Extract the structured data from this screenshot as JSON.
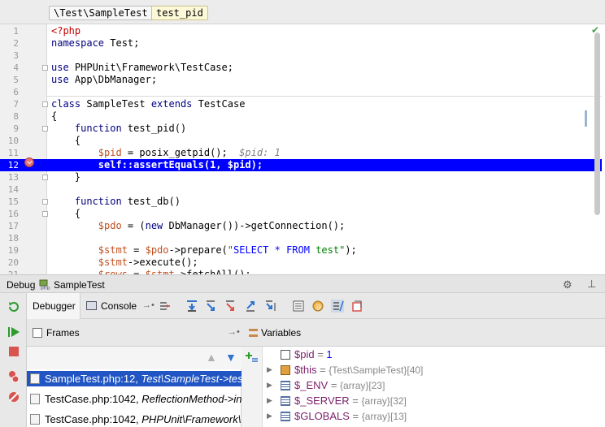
{
  "breadcrumb": {
    "namespace": "\\Test\\SampleTest",
    "method": "test_pid"
  },
  "editor": {
    "lines": [
      {
        "no": "1",
        "code": "<?php"
      },
      {
        "no": "2",
        "code": "namespace Test;"
      },
      {
        "no": "3",
        "code": ""
      },
      {
        "no": "4",
        "code": "use PHPUnit\\Framework\\TestCase;"
      },
      {
        "no": "5",
        "code": "use App\\DbManager;"
      },
      {
        "no": "6",
        "code": ""
      },
      {
        "no": "7",
        "code": "class SampleTest extends TestCase"
      },
      {
        "no": "8",
        "code": "{"
      },
      {
        "no": "9",
        "code": "    function test_pid()"
      },
      {
        "no": "10",
        "code": "    {"
      },
      {
        "no": "11",
        "code": "        $pid = posix_getpid();"
      },
      {
        "no": "12",
        "code": "        self::assertEquals(1, $pid);"
      },
      {
        "no": "13",
        "code": "    }"
      },
      {
        "no": "14",
        "code": ""
      },
      {
        "no": "15",
        "code": "    function test_db()"
      },
      {
        "no": "16",
        "code": "    {"
      },
      {
        "no": "17",
        "code": "        $pdo = (new DbManager())->getConnection();"
      },
      {
        "no": "18",
        "code": ""
      },
      {
        "no": "19",
        "code": "        $stmt = $pdo->prepare(\"SELECT * FROM test\");"
      },
      {
        "no": "20",
        "code": "        $stmt->execute();"
      },
      {
        "no": "21",
        "code": "        $rows = $stmt->fetchAll();"
      }
    ],
    "inline_hint": "$pid: 1",
    "current_line": "12"
  },
  "debug": {
    "title": "Debug",
    "session": "SampleTest",
    "tabs": {
      "debugger": "Debugger",
      "console": "Console"
    },
    "frames": {
      "header": "Frames",
      "items": [
        {
          "file": "SampleTest.php:12,",
          "method": "Test\\SampleTest->test_pid()"
        },
        {
          "file": "TestCase.php:1042,",
          "method": "ReflectionMethod->invokeArgs()"
        },
        {
          "file": "TestCase.php:1042,",
          "method": "PHPUnit\\Framework\\TestCase->runTest()"
        }
      ]
    },
    "variables": {
      "header": "Variables",
      "items": [
        {
          "name": "$pid",
          "eq": " = ",
          "type": "",
          "value": "1",
          "expandable": false,
          "icon": "primitive-icon"
        },
        {
          "name": "$this",
          "eq": " = ",
          "type": "{Test\\SampleTest}",
          "value": "[40]",
          "expandable": true,
          "icon": "object-icon"
        },
        {
          "name": "$_ENV",
          "eq": " = ",
          "type": "{array}",
          "value": "[23]",
          "expandable": true,
          "icon": "array-icon"
        },
        {
          "name": "$_SERVER",
          "eq": " = ",
          "type": "{array}",
          "value": "[32]",
          "expandable": true,
          "icon": "array-icon"
        },
        {
          "name": "$GLOBALS",
          "eq": " = ",
          "type": "{array}",
          "value": "[13]",
          "expandable": true,
          "icon": "array-icon"
        }
      ]
    }
  },
  "colors": {
    "current_line": "#0000ff",
    "selected_frame": "#2155c4",
    "accent": "#2f74d0"
  }
}
